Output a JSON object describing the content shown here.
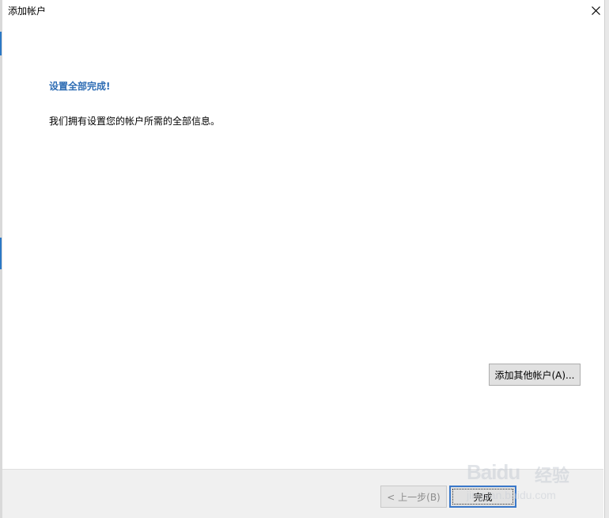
{
  "window": {
    "title": "添加帐户",
    "close_icon": "close-icon"
  },
  "content": {
    "heading": "设置全部完成!",
    "info": "我们拥有设置您的帐户所需的全部信息。",
    "add_account_button": "添加其他帐户(A)..."
  },
  "footer": {
    "back_button": "< 上一步(B)",
    "finish_button": "完成"
  },
  "watermark": {
    "brand": "Baidu",
    "jingyan": "经验",
    "url": "jingyan.baidu.com"
  },
  "colors": {
    "heading": "#2e6db4",
    "accent": "#3a78c9",
    "footer_bg": "#f0f0f0"
  }
}
